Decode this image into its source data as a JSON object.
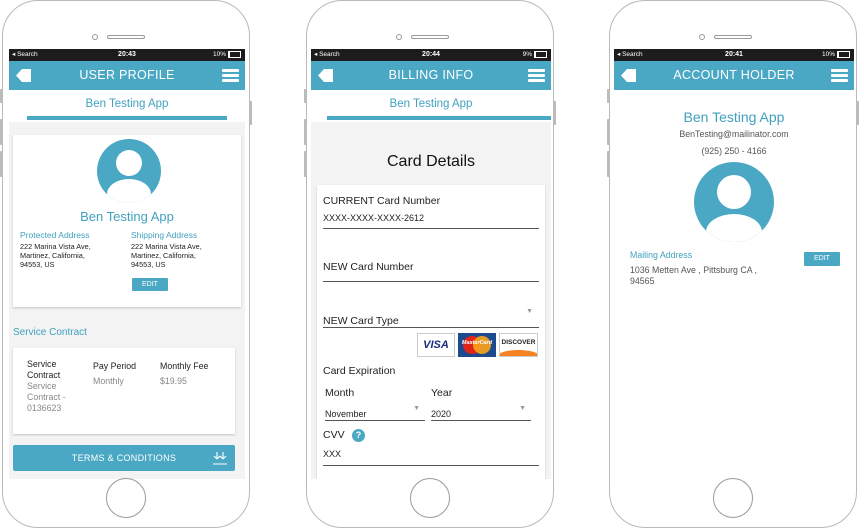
{
  "status_bar": {
    "carrier": "◂ Search",
    "phone1": {
      "time": "20:43",
      "battery": "10%"
    },
    "phone2": {
      "time": "20:44",
      "battery": "9%"
    },
    "phone3": {
      "time": "20:41",
      "battery": "10%"
    }
  },
  "profile": {
    "title": "USER PROFILE",
    "app_name": "Ben Testing App",
    "name": "Ben Testing App",
    "protected_label": "Protected Address",
    "protected_address": [
      "222 Marina Vista Ave,",
      "Martinez, California,",
      "94553, US"
    ],
    "shipping_label": "Shipping Address",
    "shipping_address": [
      "222 Marina Vista Ave,",
      "Martinez, California,",
      "94553, US"
    ],
    "edit_label": "EDIT",
    "service_heading": "Service Contract",
    "service_col_label": [
      "Service",
      "Contract"
    ],
    "service_col_value": [
      "Service",
      "Contract -",
      "0136623"
    ],
    "pay_period_label": "Pay Period",
    "pay_period_value": "Monthly",
    "monthly_fee_label": "Monthly Fee",
    "monthly_fee_value": "$19.95",
    "terms_label": "TERMS & CONDITIONS"
  },
  "billing": {
    "title": "BILLING INFO",
    "app_name": "Ben Testing App",
    "heading": "Card Details",
    "current_label": "CURRENT Card Number",
    "current_value": "XXXX-XXXX-XXXX-2612",
    "new_number_label": "NEW Card Number",
    "new_type_label": "NEW Card Type",
    "card_logos": [
      "VISA",
      "MasterCard",
      "DISCOVER"
    ],
    "expiration_label": "Card Expiration",
    "month_label": "Month",
    "month_value": "November",
    "year_label": "Year",
    "year_value": "2020",
    "cvv_label": "CVV",
    "cvv_value": "XXX"
  },
  "account": {
    "title": "ACCOUNT HOLDER",
    "name": "Ben Testing App",
    "email": "BenTesting@mailinator.com",
    "phone": "(925) 250 - 4166",
    "mailing_label": "Mailing Address",
    "mailing_address": [
      "1036 Metten Ave , Pittsburg CA ,",
      "94565"
    ],
    "edit_label": "EDIT"
  },
  "colors": {
    "accent": "#4aa8c4",
    "link_text": "#3fa1bf",
    "status_bar": "#1c1c1c"
  }
}
